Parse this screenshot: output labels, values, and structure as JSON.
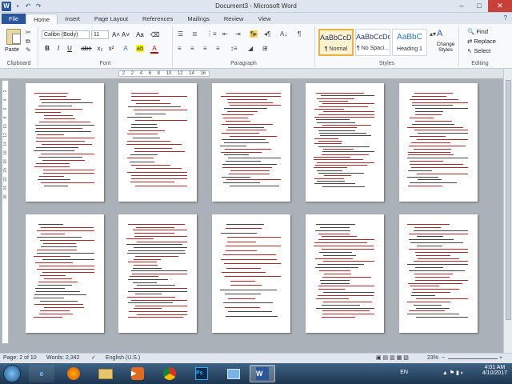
{
  "window": {
    "title": "Document3 - Microsoft Word",
    "qat": [
      "save",
      "undo",
      "redo"
    ],
    "controls": [
      "minimize",
      "maximize",
      "close"
    ]
  },
  "tabs": [
    {
      "label": "File"
    },
    {
      "label": "Home"
    },
    {
      "label": "Insert"
    },
    {
      "label": "Page Layout"
    },
    {
      "label": "References"
    },
    {
      "label": "Mailings"
    },
    {
      "label": "Review"
    },
    {
      "label": "View"
    }
  ],
  "ribbon": {
    "clipboard": {
      "paste_label": "Paste",
      "group_label": "Clipboard"
    },
    "font": {
      "font_name": "Calibri (Body)",
      "font_size": "11",
      "group_label": "Font",
      "buttons": [
        "B",
        "I",
        "U",
        "abe",
        "x₂",
        "x²",
        "A",
        "Aa",
        "A"
      ]
    },
    "paragraph": {
      "group_label": "Paragraph"
    },
    "styles": {
      "group_label": "Styles",
      "cards": [
        {
          "preview": "AaBbCcDc",
          "name": "¶ Normal"
        },
        {
          "preview": "AaBbCcDc",
          "name": "¶ No Spaci..."
        },
        {
          "preview": "AaBbC",
          "name": "Heading 1"
        }
      ],
      "change_styles": "Change Styles"
    },
    "editing": {
      "group_label": "Editing",
      "find": "Find",
      "replace": "Replace",
      "select": "Select"
    }
  },
  "ruler": {
    "ticks": [
      "2",
      "2",
      "4",
      "6",
      "8",
      "10",
      "12",
      "14",
      "16"
    ]
  },
  "vruler": {
    "ticks": [
      "2",
      "4",
      "6",
      "8",
      "10",
      "12",
      "14",
      "16",
      "18",
      "20",
      "22",
      "24",
      "26"
    ]
  },
  "status": {
    "page": "Page: 2 of 10",
    "words": "Words: 2,342",
    "language": "English (U.S.)",
    "zoom": "23%"
  },
  "taskbar": {
    "time": "4:01 AM",
    "date": "4/10/2017",
    "lang": "EN"
  },
  "colors": {
    "accent": "#2b579a",
    "track_change": "#b3262a"
  }
}
